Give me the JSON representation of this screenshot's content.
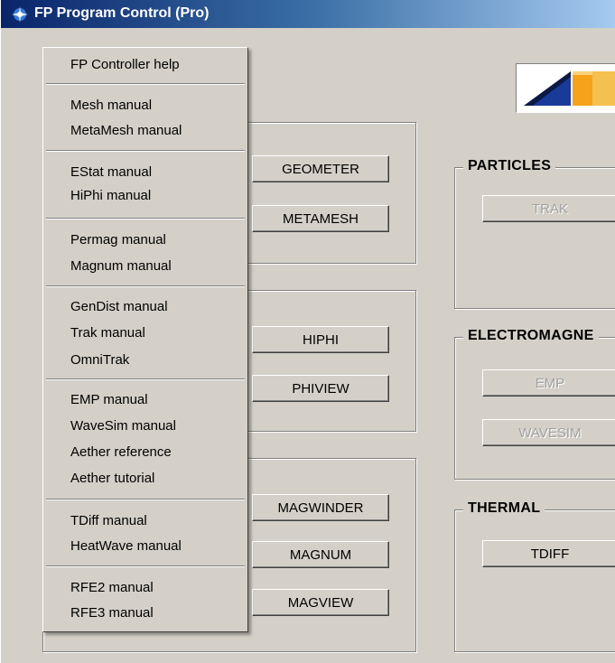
{
  "window": {
    "title": "FP Program Control (Pro)"
  },
  "menu": {
    "items": [
      "FP Controller help",
      "Mesh manual",
      "MetaMesh manual",
      "EStat manual",
      "HiPhi manual",
      "Permag manual",
      "Magnum manual",
      "GenDist manual",
      "Trak manual",
      "OmniTrak",
      "EMP manual",
      "WaveSim manual",
      "Aether reference",
      "Aether tutorial",
      "TDiff manual",
      "HeatWave manual",
      "RFE2 manual",
      "RFE3 manual"
    ]
  },
  "buttons": {
    "geometer": "GEOMETER",
    "metamesh": "METAMESH",
    "hiphi": "HIPHI",
    "phiview": "PHIVIEW",
    "magwinder": "MAGWINDER",
    "magnum": "MAGNUM",
    "magview": "MAGVIEW",
    "trak": "TRAK",
    "emp": "EMP",
    "wavesim": "WAVESIM",
    "tdiff": "TDIFF"
  },
  "groups": {
    "particles": "PARTICLES",
    "electromagnetic": "ELECTROMAGNE",
    "thermal": "THERMAL"
  },
  "colors": {
    "title_start": "#0a246a",
    "title_end": "#a6caf0",
    "face": "#d4d0c8",
    "logo_orange": "#f7a21b",
    "logo_blue": "#1a3a9a"
  }
}
